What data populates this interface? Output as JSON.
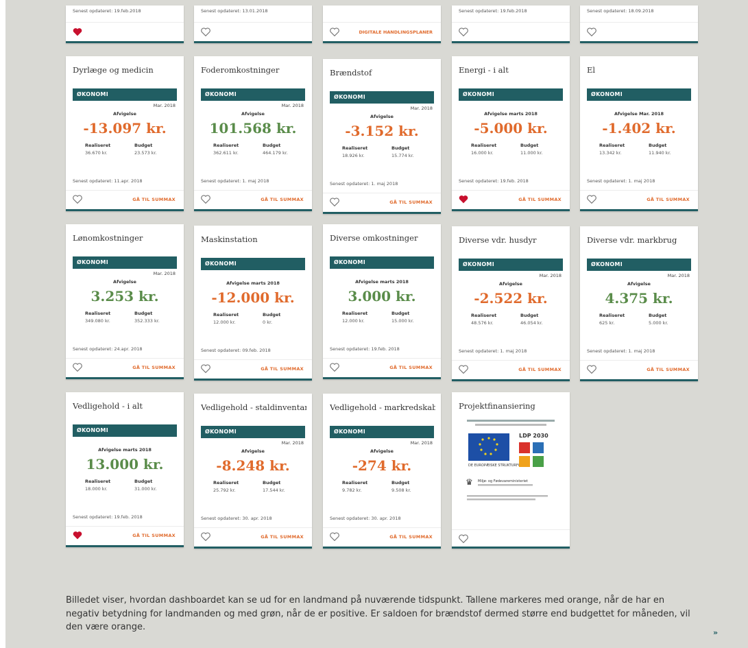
{
  "colors": {
    "brand": "#215e63",
    "negative": "#e06a2c",
    "positive": "#5a8c4a",
    "heart_filled": "#c8102e"
  },
  "top_row": [
    {
      "updated": "Senest opdateret: 19.feb.2018",
      "favorite": true,
      "action": ""
    },
    {
      "updated": "Senest opdateret: 13.01.2018",
      "favorite": false,
      "action": ""
    },
    {
      "updated": "",
      "favorite": false,
      "action": "DIGITALE HANDLINGSPLANER"
    },
    {
      "updated": "Senest opdateret: 19.feb.2018",
      "favorite": false,
      "action": ""
    },
    {
      "updated": "Senest opdateret: 18.09.2018",
      "favorite": false,
      "action": ""
    }
  ],
  "cards": [
    {
      "title": "Dyrlæge og medicin",
      "section": "ØKONOMI",
      "period": "Mar. 2018",
      "sublabel": "Afvigelse",
      "amount": "-13.097 kr.",
      "tone": "negative",
      "realized_label": "Realiseret",
      "realized": "36.670 kr.",
      "budget_label": "Budget",
      "budget": "23.573 kr.",
      "updated": "Senest opdateret: 11.apr. 2018",
      "favorite": false,
      "action": "GÅ TIL SUMMAX"
    },
    {
      "title": "Foderomkostninger",
      "section": "ØKONOMI",
      "period": "Mar. 2018",
      "sublabel": "Afvigelse",
      "amount": "101.568 kr.",
      "tone": "positive",
      "realized_label": "Realiseret",
      "realized": "362.611 kr.",
      "budget_label": "Budget",
      "budget": "464.179 kr.",
      "updated": "Senest opdateret: 1. maj 2018",
      "favorite": false,
      "action": "GÅ TIL SUMMAX"
    },
    {
      "title": "Brændstof",
      "section": "ØKONOMI",
      "period": "Mar. 2018",
      "sublabel": "Afvigelse",
      "amount": "-3.152 kr.",
      "tone": "negative",
      "realized_label": "Realiseret",
      "realized": "18.926 kr.",
      "budget_label": "Budget",
      "budget": "15.774 kr.",
      "updated": "Senest opdateret: 1. maj 2018",
      "favorite": false,
      "action": "GÅ TIL SUMMAX"
    },
    {
      "title": "Energi - i alt",
      "section": "ØKONOMI",
      "period": "",
      "sublabel": "Afvigelse marts 2018",
      "amount": "-5.000 kr.",
      "tone": "negative",
      "realized_label": "Realiseret",
      "realized": "16.000 kr.",
      "budget_label": "Budget",
      "budget": "11.000 kr.",
      "updated": "Senest opdateret: 19.feb. 2018",
      "favorite": true,
      "action": "GÅ TIL SUMMAX"
    },
    {
      "title": "El",
      "section": "ØKONOMI",
      "period": "",
      "sublabel": "Afvigelse Mar. 2018",
      "amount": "-1.402 kr.",
      "tone": "negative",
      "realized_label": "Realiseret",
      "realized": "13.342 kr.",
      "budget_label": "Budget",
      "budget": "11.940 kr.",
      "updated": "Senest opdateret: 1. maj 2018",
      "favorite": false,
      "action": "GÅ TIL SUMMAX"
    },
    {
      "title": "Lønomkostninger",
      "section": "ØKONOMI",
      "period": "Mar. 2018",
      "sublabel": "Afvigelse",
      "amount": "3.253 kr.",
      "tone": "positive",
      "realized_label": "Realiseret",
      "realized": "349.080 kr.",
      "budget_label": "Budget",
      "budget": "352.333 kr.",
      "updated": "Senest opdateret: 24.apr. 2018",
      "favorite": false,
      "action": "GÅ TIL SUMMAX"
    },
    {
      "title": "Maskinstation",
      "section": "ØKONOMI",
      "period": "",
      "sublabel": "Afvigelse marts 2018",
      "amount": "-12.000 kr.",
      "tone": "negative",
      "realized_label": "Realiseret",
      "realized": "12.000 kr.",
      "budget_label": "Budget",
      "budget": "0 kr.",
      "updated": "Senest opdateret: 09.feb. 2018",
      "favorite": false,
      "action": "GÅ TIL SUMMAX"
    },
    {
      "title": "Diverse omkostninger",
      "section": "ØKONOMI",
      "period": "",
      "sublabel": "Afvigelse marts 2018",
      "amount": "3.000 kr.",
      "tone": "positive",
      "realized_label": "Realiseret",
      "realized": "12.000 kr.",
      "budget_label": "Budget",
      "budget": "15.000 kr.",
      "updated": "Senest opdateret: 19.feb. 2018",
      "favorite": false,
      "action": "GÅ TIL SUMMAX"
    },
    {
      "title": "Diverse vdr. husdyr",
      "section": "ØKONOMI",
      "period": "Mar. 2018",
      "sublabel": "Afvigelse",
      "amount": "-2.522 kr.",
      "tone": "negative",
      "realized_label": "Realiseret",
      "realized": "48.576 kr.",
      "budget_label": "Budget",
      "budget": "46.054 kr.",
      "updated": "Senest opdateret: 1. maj 2018",
      "favorite": false,
      "action": "GÅ TIL SUMMAX"
    },
    {
      "title": "Diverse vdr. markbrug",
      "section": "ØKONOMI",
      "period": "Mar. 2018",
      "sublabel": "Afvigelse",
      "amount": "4.375 kr.",
      "tone": "positive",
      "realized_label": "Realiseret",
      "realized": "625 kr.",
      "budget_label": "Budget",
      "budget": "5.000 kr.",
      "updated": "Senest opdateret: 1. maj 2018",
      "favorite": false,
      "action": "GÅ TIL SUMMAX"
    },
    {
      "title": "Vedligehold - i alt",
      "section": "ØKONOMI",
      "period": "",
      "sublabel": "Afvigelse marts 2018",
      "amount": "13.000 kr.",
      "tone": "positive",
      "realized_label": "Realiseret",
      "realized": "18.000 kr.",
      "budget_label": "Budget",
      "budget": "31.000 kr.",
      "updated": "Senest opdateret: 19.feb. 2018",
      "favorite": true,
      "action": "GÅ TIL SUMMAX"
    },
    {
      "title": "Vedligehold - staldinventar",
      "section": "ØKONOMI",
      "period": "Mar. 2018",
      "sublabel": "Afvigelse",
      "amount": "-8.248 kr.",
      "tone": "negative",
      "realized_label": "Realiseret",
      "realized": "25.792 kr.",
      "budget_label": "Budget",
      "budget": "17.544 kr.",
      "updated": "Senest opdateret: 30. apr. 2018",
      "favorite": false,
      "action": "GÅ TIL SUMMAX"
    },
    {
      "title": "Vedligehold - markredskaber",
      "section": "ØKONOMI",
      "period": "Mar. 2018",
      "sublabel": "Afvigelse",
      "amount": "-274 kr.",
      "tone": "negative",
      "realized_label": "Realiseret",
      "realized": "9.782 kr.",
      "budget_label": "Budget",
      "budget": "9.508 kr.",
      "updated": "Senest opdateret: 30. apr. 2018",
      "favorite": false,
      "action": "GÅ TIL SUMMAX"
    }
  ],
  "project_card": {
    "title": "Projektfinansiering",
    "eu_text": "DE EUROPÆISKE STRUKTURFONDE",
    "ldp_text": "LDP 2030",
    "ministry_text": "Miljø- og Fødevareministeriet"
  },
  "caption": "Billedet viser, hvordan dashboardet kan se ud for en landmand på nuværende tidspunkt. Tallene markeres med orange, når de har en negativ betydning for landmanden og med grøn, når de er positive. Er saldoen for brændstof dermed større end budgettet for måneden, vil den være orange.",
  "next_icon": "»"
}
